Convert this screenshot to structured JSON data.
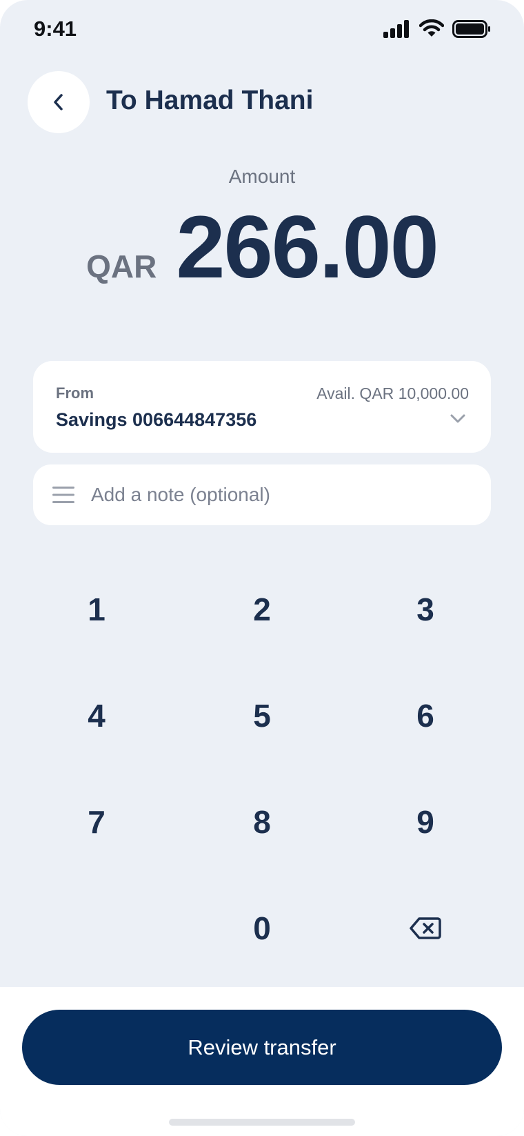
{
  "status_bar": {
    "time": "9:41",
    "icons": [
      "cellular-signal-icon",
      "wifi-icon",
      "battery-icon"
    ]
  },
  "header": {
    "back_icon": "chevron-left-icon",
    "title": "To Hamad Thani"
  },
  "amount": {
    "label": "Amount",
    "currency": "QAR",
    "value": "266.00"
  },
  "from_account": {
    "label": "From",
    "available": "Avail. QAR 10,000.00",
    "account": "Savings 006644847356",
    "chevron_icon": "chevron-down-icon"
  },
  "note": {
    "icon": "menu-lines-icon",
    "placeholder": "Add a note (optional)",
    "value": ""
  },
  "keypad": {
    "k1": "1",
    "k2": "2",
    "k3": "3",
    "k4": "4",
    "k5": "5",
    "k6": "6",
    "k7": "7",
    "k8": "8",
    "k9": "9",
    "k0": "0",
    "backspace_icon": "backspace-icon"
  },
  "actions": {
    "review_label": "Review transfer"
  },
  "colors": {
    "background": "#ecf0f6",
    "primary_text": "#1c2f4e",
    "muted_text": "#6b7280",
    "button": "#062d5d",
    "card": "#ffffff"
  }
}
